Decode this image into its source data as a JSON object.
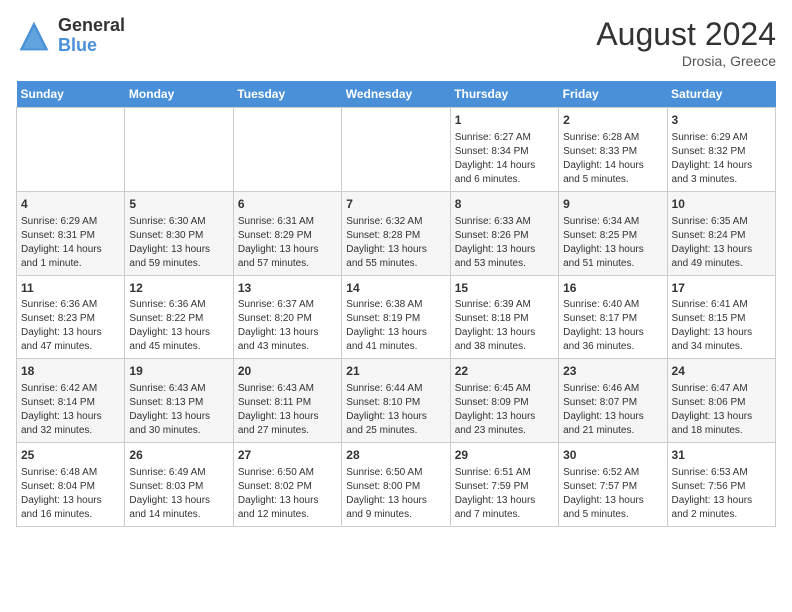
{
  "logo": {
    "general": "General",
    "blue": "Blue"
  },
  "title": "August 2024",
  "subtitle": "Drosia, Greece",
  "days_of_week": [
    "Sunday",
    "Monday",
    "Tuesday",
    "Wednesday",
    "Thursday",
    "Friday",
    "Saturday"
  ],
  "weeks": [
    [
      {
        "day": "",
        "info": ""
      },
      {
        "day": "",
        "info": ""
      },
      {
        "day": "",
        "info": ""
      },
      {
        "day": "",
        "info": ""
      },
      {
        "day": "1",
        "info": "Sunrise: 6:27 AM\nSunset: 8:34 PM\nDaylight: 14 hours and 6 minutes."
      },
      {
        "day": "2",
        "info": "Sunrise: 6:28 AM\nSunset: 8:33 PM\nDaylight: 14 hours and 5 minutes."
      },
      {
        "day": "3",
        "info": "Sunrise: 6:29 AM\nSunset: 8:32 PM\nDaylight: 14 hours and 3 minutes."
      }
    ],
    [
      {
        "day": "4",
        "info": "Sunrise: 6:29 AM\nSunset: 8:31 PM\nDaylight: 14 hours and 1 minute."
      },
      {
        "day": "5",
        "info": "Sunrise: 6:30 AM\nSunset: 8:30 PM\nDaylight: 13 hours and 59 minutes."
      },
      {
        "day": "6",
        "info": "Sunrise: 6:31 AM\nSunset: 8:29 PM\nDaylight: 13 hours and 57 minutes."
      },
      {
        "day": "7",
        "info": "Sunrise: 6:32 AM\nSunset: 8:28 PM\nDaylight: 13 hours and 55 minutes."
      },
      {
        "day": "8",
        "info": "Sunrise: 6:33 AM\nSunset: 8:26 PM\nDaylight: 13 hours and 53 minutes."
      },
      {
        "day": "9",
        "info": "Sunrise: 6:34 AM\nSunset: 8:25 PM\nDaylight: 13 hours and 51 minutes."
      },
      {
        "day": "10",
        "info": "Sunrise: 6:35 AM\nSunset: 8:24 PM\nDaylight: 13 hours and 49 minutes."
      }
    ],
    [
      {
        "day": "11",
        "info": "Sunrise: 6:36 AM\nSunset: 8:23 PM\nDaylight: 13 hours and 47 minutes."
      },
      {
        "day": "12",
        "info": "Sunrise: 6:36 AM\nSunset: 8:22 PM\nDaylight: 13 hours and 45 minutes."
      },
      {
        "day": "13",
        "info": "Sunrise: 6:37 AM\nSunset: 8:20 PM\nDaylight: 13 hours and 43 minutes."
      },
      {
        "day": "14",
        "info": "Sunrise: 6:38 AM\nSunset: 8:19 PM\nDaylight: 13 hours and 41 minutes."
      },
      {
        "day": "15",
        "info": "Sunrise: 6:39 AM\nSunset: 8:18 PM\nDaylight: 13 hours and 38 minutes."
      },
      {
        "day": "16",
        "info": "Sunrise: 6:40 AM\nSunset: 8:17 PM\nDaylight: 13 hours and 36 minutes."
      },
      {
        "day": "17",
        "info": "Sunrise: 6:41 AM\nSunset: 8:15 PM\nDaylight: 13 hours and 34 minutes."
      }
    ],
    [
      {
        "day": "18",
        "info": "Sunrise: 6:42 AM\nSunset: 8:14 PM\nDaylight: 13 hours and 32 minutes."
      },
      {
        "day": "19",
        "info": "Sunrise: 6:43 AM\nSunset: 8:13 PM\nDaylight: 13 hours and 30 minutes."
      },
      {
        "day": "20",
        "info": "Sunrise: 6:43 AM\nSunset: 8:11 PM\nDaylight: 13 hours and 27 minutes."
      },
      {
        "day": "21",
        "info": "Sunrise: 6:44 AM\nSunset: 8:10 PM\nDaylight: 13 hours and 25 minutes."
      },
      {
        "day": "22",
        "info": "Sunrise: 6:45 AM\nSunset: 8:09 PM\nDaylight: 13 hours and 23 minutes."
      },
      {
        "day": "23",
        "info": "Sunrise: 6:46 AM\nSunset: 8:07 PM\nDaylight: 13 hours and 21 minutes."
      },
      {
        "day": "24",
        "info": "Sunrise: 6:47 AM\nSunset: 8:06 PM\nDaylight: 13 hours and 18 minutes."
      }
    ],
    [
      {
        "day": "25",
        "info": "Sunrise: 6:48 AM\nSunset: 8:04 PM\nDaylight: 13 hours and 16 minutes."
      },
      {
        "day": "26",
        "info": "Sunrise: 6:49 AM\nSunset: 8:03 PM\nDaylight: 13 hours and 14 minutes."
      },
      {
        "day": "27",
        "info": "Sunrise: 6:50 AM\nSunset: 8:02 PM\nDaylight: 13 hours and 12 minutes."
      },
      {
        "day": "28",
        "info": "Sunrise: 6:50 AM\nSunset: 8:00 PM\nDaylight: 13 hours and 9 minutes."
      },
      {
        "day": "29",
        "info": "Sunrise: 6:51 AM\nSunset: 7:59 PM\nDaylight: 13 hours and 7 minutes."
      },
      {
        "day": "30",
        "info": "Sunrise: 6:52 AM\nSunset: 7:57 PM\nDaylight: 13 hours and 5 minutes."
      },
      {
        "day": "31",
        "info": "Sunrise: 6:53 AM\nSunset: 7:56 PM\nDaylight: 13 hours and 2 minutes."
      }
    ]
  ]
}
